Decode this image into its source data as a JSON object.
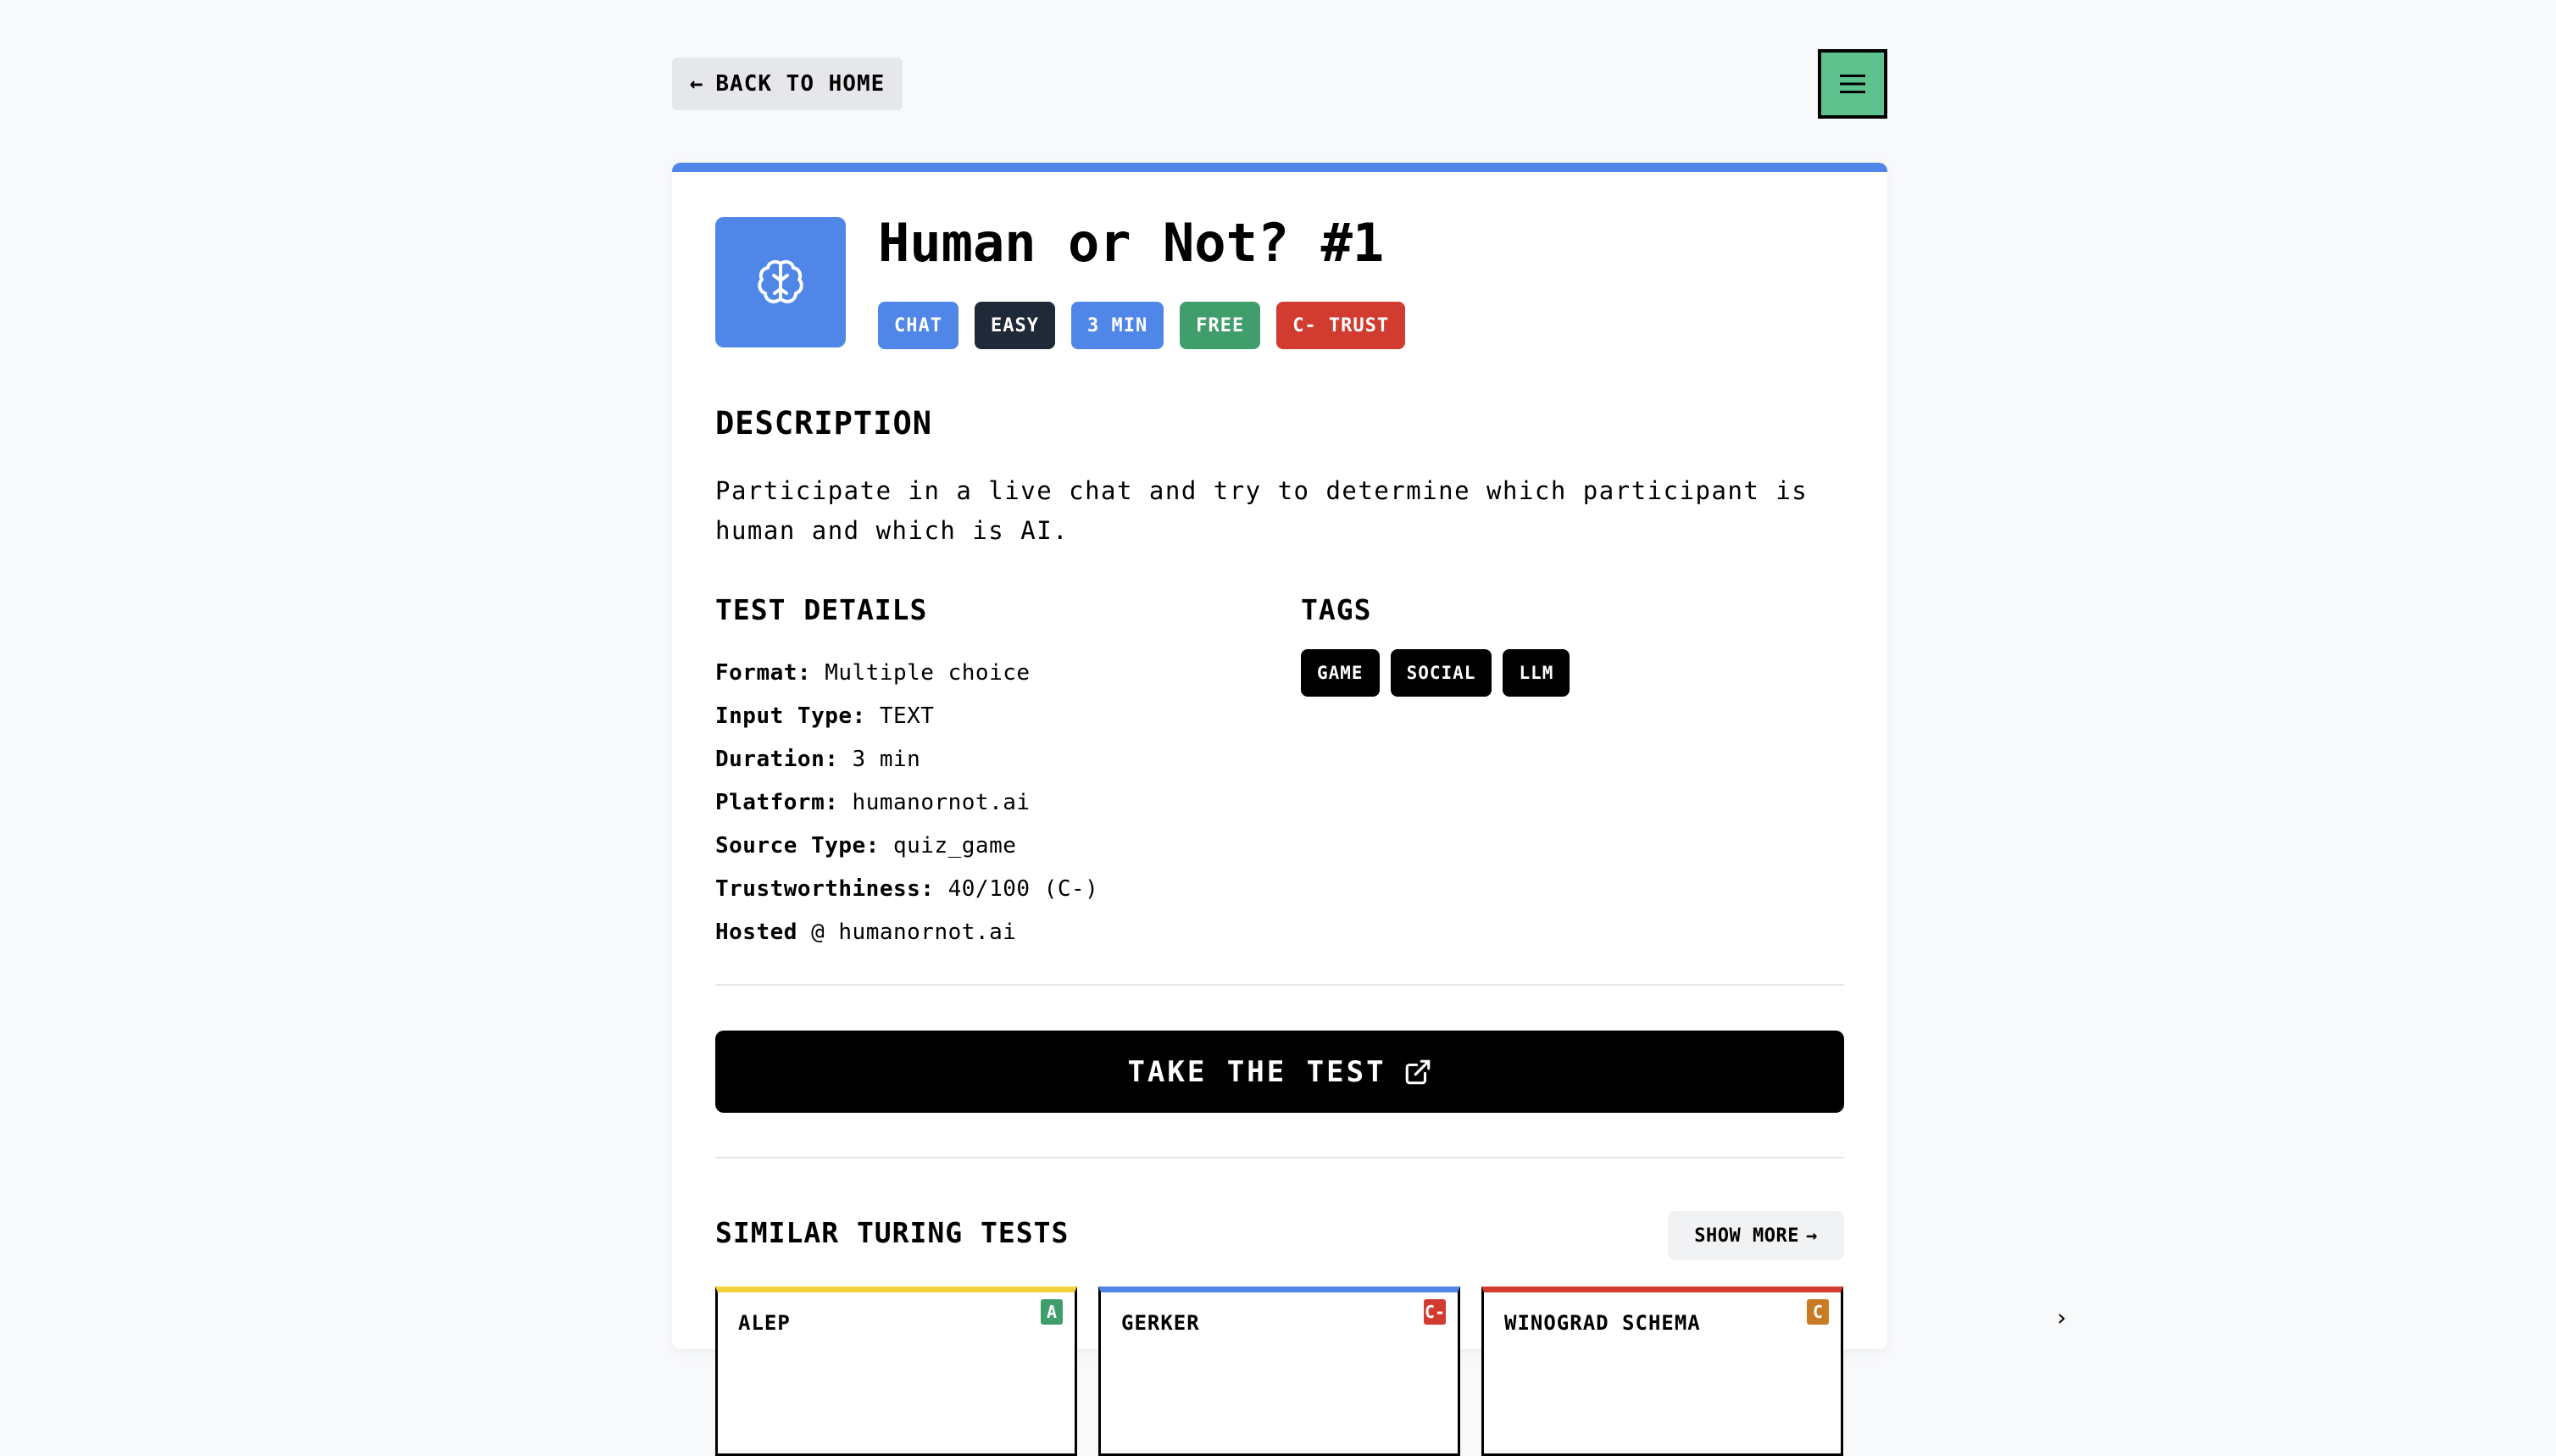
{
  "nav": {
    "back_label": "BACK TO HOME"
  },
  "test": {
    "title": "Human or Not? #1",
    "badges": [
      {
        "label": "CHAT",
        "color": "#4f86e8"
      },
      {
        "label": "EASY",
        "color": "#1f2937"
      },
      {
        "label": "3 MIN",
        "color": "#4f86e8"
      },
      {
        "label": "FREE",
        "color": "#3f9e6c"
      },
      {
        "label": "C- TRUST",
        "color": "#d13b30"
      }
    ],
    "description_heading": "DESCRIPTION",
    "description": "Participate in a live chat and try to determine which participant is human and which is AI.",
    "details_heading": "TEST DETAILS",
    "details": [
      {
        "label": "Format:",
        "value": "Multiple choice"
      },
      {
        "label": "Input Type:",
        "value": "TEXT"
      },
      {
        "label": "Duration:",
        "value": "3 min"
      },
      {
        "label": "Platform:",
        "value": "humanornot.ai"
      },
      {
        "label": "Source Type:",
        "value": "quiz_game"
      },
      {
        "label": "Trustworthiness:",
        "value": "40/100 (C-)"
      },
      {
        "label": "Hosted",
        "value": "@ humanornot.ai"
      }
    ],
    "tags_heading": "TAGS",
    "tags": [
      "GAME",
      "SOCIAL",
      "LLM"
    ],
    "cta_label": "TAKE THE TEST"
  },
  "similar": {
    "heading": "SIMILAR TURING TESTS",
    "show_more_label": "SHOW MORE",
    "cards": [
      {
        "name": "ALEP",
        "grade": "A",
        "accent": "#f3d23b",
        "grade_color": "#3f9e6c"
      },
      {
        "name": "GERKER",
        "grade": "C-",
        "accent": "#4f86e8",
        "grade_color": "#d13b30"
      },
      {
        "name": "WINOGRAD SCHEMA",
        "grade": "C",
        "accent": "#d13b30",
        "grade_color": "#c97a25"
      }
    ]
  },
  "colors": {
    "accent": "#4f86e8",
    "menu_bg": "#5ec28f"
  }
}
